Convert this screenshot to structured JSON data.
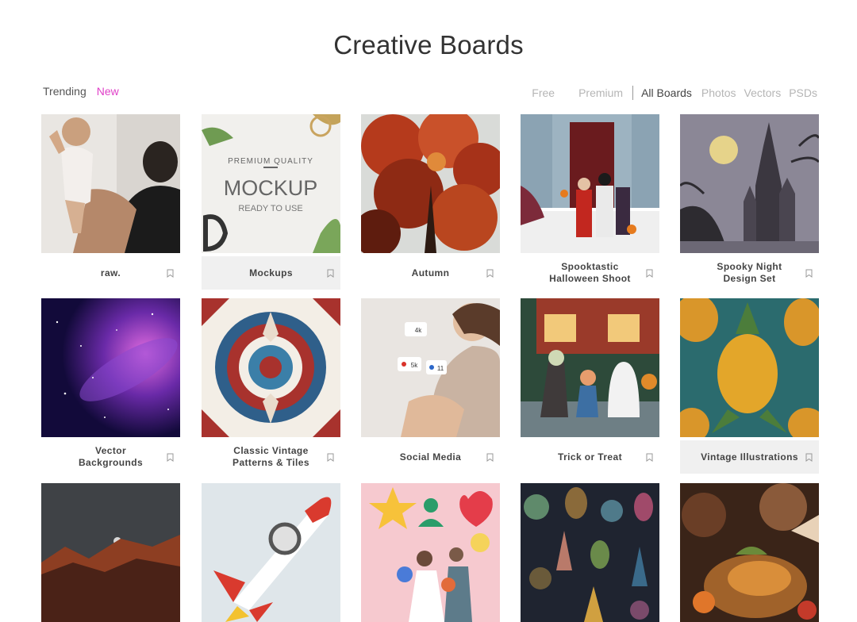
{
  "page": {
    "title": "Creative Boards"
  },
  "sort": {
    "trending": "Trending",
    "new": "New"
  },
  "filters": {
    "free": "Free",
    "premium": "Premium",
    "all_boards": "All Boards",
    "photos": "Photos",
    "vectors": "Vectors",
    "psds": "PSDs"
  },
  "boards": [
    {
      "title": "raw."
    },
    {
      "title": "Mockups"
    },
    {
      "title": "Autumn"
    },
    {
      "title": "Spooktastic Halloween Shoot"
    },
    {
      "title": "Spooky Night Design Set"
    },
    {
      "title": "Vector Backgrounds"
    },
    {
      "title": "Classic Vintage Patterns & Tiles"
    },
    {
      "title": "Social Media"
    },
    {
      "title": "Trick or Treat"
    },
    {
      "title": "Vintage Illustrations"
    }
  ],
  "thumb_text": {
    "mockup_top": "PREMIUM QUALITY",
    "mockup_main": "MOCKUP",
    "mockup_sub": "READY TO USE",
    "likes_4k": "4k",
    "likes_5k": "5k",
    "likes_11": "11"
  },
  "colors": {
    "accent": "#e040c8",
    "caption_highlight": "#f0f0f0"
  }
}
